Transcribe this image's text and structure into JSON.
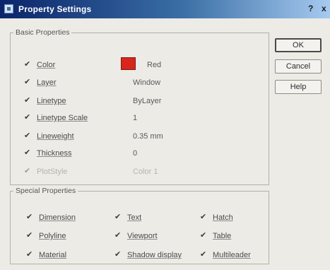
{
  "window": {
    "title": "Property Settings",
    "help_glyph": "?",
    "close_glyph": "x"
  },
  "basic": {
    "legend": "Basic Properties",
    "color": {
      "label": "Color",
      "value": "Red",
      "swatch": "#d7261c"
    },
    "layer": {
      "label": "Layer",
      "value": "Window"
    },
    "linetype": {
      "label": "Linetype",
      "value": "ByLayer"
    },
    "linetype_scale": {
      "label": "Linetype Scale",
      "value": "1"
    },
    "lineweight": {
      "label": "Lineweight",
      "value": "0.35 mm"
    },
    "thickness": {
      "label": "Thickness",
      "value": "0"
    },
    "plot_style": {
      "label": "PlotStyle",
      "value": "Color 1"
    }
  },
  "special": {
    "legend": "Special Properties",
    "items": [
      "Dimension",
      "Text",
      "Hatch",
      "Polyline",
      "Viewport",
      "Table",
      "Material",
      "Shadow display",
      "Multileader"
    ]
  },
  "buttons": {
    "ok": "OK",
    "cancel": "Cancel",
    "help": "Help"
  }
}
